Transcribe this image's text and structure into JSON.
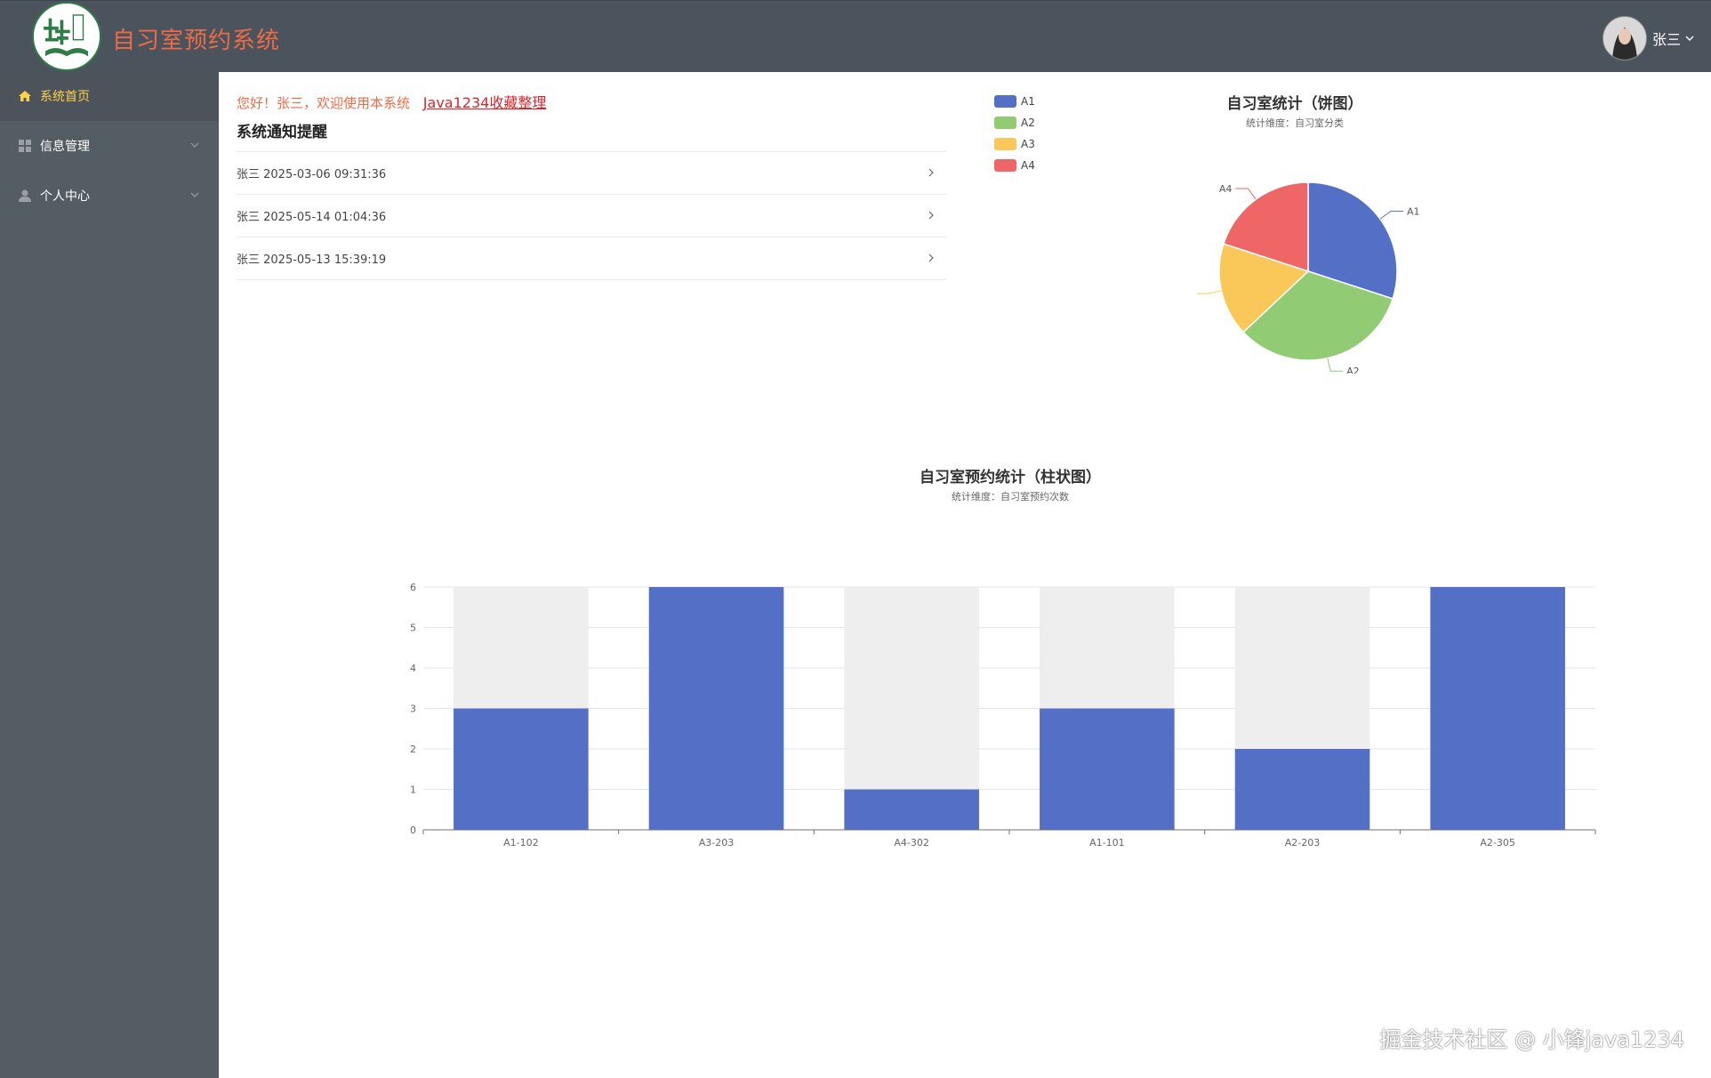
{
  "header": {
    "app_title": "自习室预约系统",
    "user_name": "张三"
  },
  "sidebar": {
    "items": [
      {
        "label": "系统首页",
        "icon": "home-icon",
        "active": true
      },
      {
        "label": "信息管理",
        "icon": "grid-icon"
      },
      {
        "label": "个人中心",
        "icon": "user-icon"
      }
    ]
  },
  "welcome": {
    "text": "您好！张三，欢迎使用本系统",
    "link": "Java1234收藏整理"
  },
  "notices": {
    "title": "系统通知提醒",
    "items": [
      "张三 2025-03-06 09:31:36",
      "张三 2025-05-14 01:04:36",
      "张三 2025-05-13 15:39:19"
    ]
  },
  "colors": {
    "accent": "#ee6b48",
    "header_bg": "#4b535d",
    "sidebar_bg": "#545c64",
    "active_text": "#ffd04b",
    "blue": "#5470c6",
    "green": "#91cc75",
    "yellow": "#fac858",
    "red": "#ee6666"
  },
  "chart_data": [
    {
      "type": "pie",
      "title": "自习室统计（饼图）",
      "subtitle": "统计维度：自习室分类",
      "legend_position": "top-left",
      "categories": [
        "A1",
        "A2",
        "A3",
        "A4"
      ],
      "values": [
        30,
        33,
        17,
        20
      ],
      "colors": [
        "#5470c6",
        "#91cc75",
        "#fac858",
        "#ee6666"
      ]
    },
    {
      "type": "bar",
      "title": "自习室预约统计（柱状图）",
      "subtitle": "统计维度：自习室预约次数",
      "categories": [
        "A1-102",
        "A3-203",
        "A4-302",
        "A1-101",
        "A2-203",
        "A2-305"
      ],
      "values": [
        3,
        6,
        1,
        3,
        2,
        6
      ],
      "ylim": [
        0,
        6
      ],
      "yticks": [
        "0",
        "1",
        "2",
        "3",
        "4",
        "5",
        "6"
      ],
      "show_background": true,
      "grid": true,
      "color": "#5470c6"
    }
  ],
  "watermark": "掘金技术社区 @ 小锋java1234"
}
